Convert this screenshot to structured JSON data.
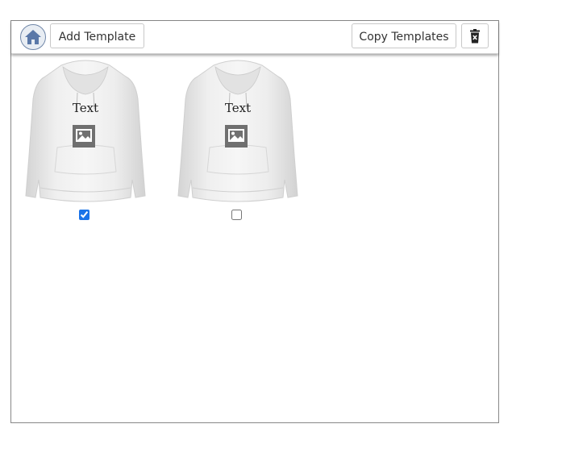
{
  "toolbar": {
    "home_icon": "home-icon",
    "add_template_label": "Add Template",
    "copy_templates_label": "Copy Templates",
    "delete_icon": "trash-icon"
  },
  "templates": [
    {
      "text": "Text",
      "image_icon": "image-placeholder-icon",
      "checked": true
    },
    {
      "text": "Text",
      "image_icon": "image-placeholder-icon",
      "checked": false
    }
  ],
  "colors": {
    "home_icon": "#5a78a8",
    "checkbox_accent": "#1a73e8",
    "hoodie": "#e6e6e6"
  }
}
